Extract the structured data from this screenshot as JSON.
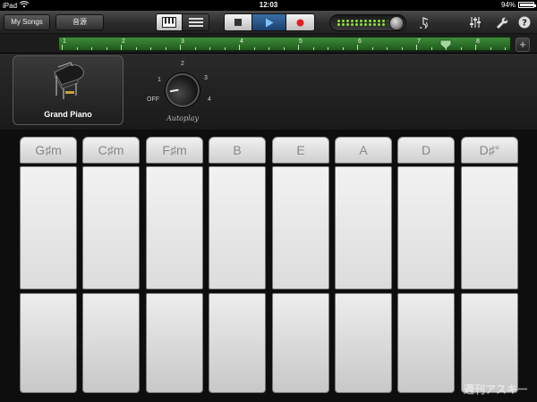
{
  "status_bar": {
    "device": "iPad",
    "time": "12:03",
    "battery": "94%",
    "battery_level": 0.94
  },
  "toolbar": {
    "my_songs_label": "My Songs",
    "sound_label": "音源",
    "view_toggle_icons": [
      "keyboard-view-icon",
      "track-list-icon"
    ],
    "transport_icons": [
      "stop-icon",
      "play-icon",
      "record-icon"
    ],
    "right_icons": [
      "metronome-icon",
      "mixer-icon",
      "wrench-icon",
      "help-icon"
    ],
    "accent_play": "#2a5590",
    "record_color": "#e02020",
    "meter_color": "#8de23a"
  },
  "ruler": {
    "bars": [
      "1",
      "2",
      "3",
      "4",
      "5",
      "6",
      "7",
      "8"
    ],
    "add_label": "+",
    "playhead_bar": 7.5,
    "ruler_color": "#2f7a2a"
  },
  "instrument": {
    "name": "Grand Piano",
    "icon": "grand-piano-icon"
  },
  "autoplay": {
    "title": "Autoplay",
    "off_label": "OFF",
    "dial_labels": [
      "1",
      "2",
      "3",
      "4"
    ],
    "selected": "OFF"
  },
  "chords": [
    "G♯m",
    "C♯m",
    "F♯m",
    "B",
    "E",
    "A",
    "D",
    "D♯°"
  ],
  "watermark": "週刊アスキー"
}
